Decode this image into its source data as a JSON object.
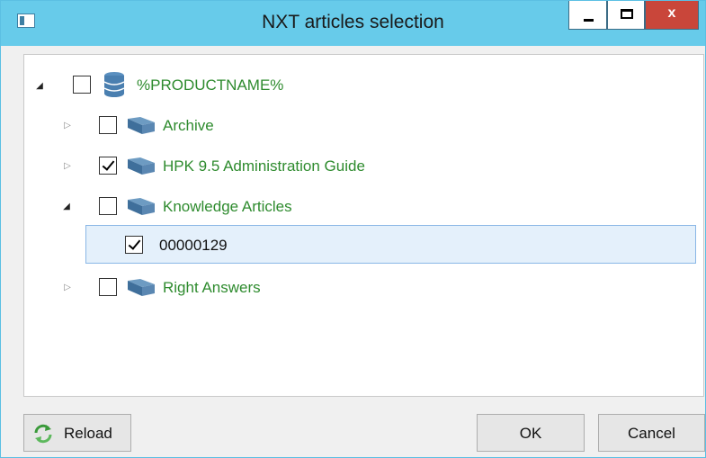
{
  "window": {
    "title": "NXT articles selection"
  },
  "tree": {
    "root": {
      "label": "%PRODUCTNAME%",
      "checked": false,
      "expanded": true,
      "icon": "database-icon"
    },
    "children": [
      {
        "label": "Archive",
        "checked": false,
        "expanded": false,
        "icon": "book-icon"
      },
      {
        "label": "HPK 9.5 Administration Guide",
        "checked": true,
        "expanded": false,
        "icon": "book-icon"
      },
      {
        "label": "Knowledge Articles",
        "checked": false,
        "expanded": true,
        "icon": "book-icon",
        "children": [
          {
            "label": "00000129",
            "checked": true,
            "selected": true
          }
        ]
      },
      {
        "label": "Right Answers",
        "checked": false,
        "expanded": false,
        "icon": "book-icon"
      }
    ]
  },
  "buttons": {
    "reload": "Reload",
    "ok": "OK",
    "cancel": "Cancel"
  },
  "colors": {
    "titlebar": "#67cbea",
    "close": "#c9463a",
    "tree_label": "#2e8b2e",
    "selection": "#e4f0fb"
  }
}
